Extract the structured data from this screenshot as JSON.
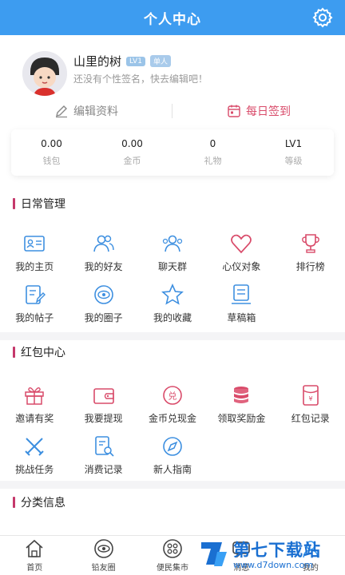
{
  "header": {
    "title": "个人中心"
  },
  "profile": {
    "username": "山里的树",
    "badges": [
      "LV1",
      "单人"
    ],
    "signature": "还没有个性签名，快去编辑吧！"
  },
  "actions": {
    "edit": "编辑资料",
    "checkin": "每日签到"
  },
  "stats": [
    {
      "value": "0.00",
      "label": "钱包"
    },
    {
      "value": "0.00",
      "label": "金币"
    },
    {
      "value": "0",
      "label": "礼物"
    },
    {
      "value": "LV1",
      "label": "等级"
    }
  ],
  "sections": {
    "daily": {
      "title": "日常管理",
      "items": [
        "我的主页",
        "我的好友",
        "聊天群",
        "心仪对象",
        "排行榜",
        "我的帖子",
        "我的圈子",
        "我的收藏",
        "草稿箱"
      ]
    },
    "redpacket": {
      "title": "红包中心",
      "items": [
        "邀请有奖",
        "我要提现",
        "金币兑现金",
        "领取奖励金",
        "红包记录",
        "挑战任务",
        "消费记录",
        "新人指南"
      ]
    },
    "category": {
      "title": "分类信息"
    }
  },
  "tabbar": [
    "首页",
    "铅友圈",
    "便民集市",
    "消息",
    "我的"
  ],
  "watermark": {
    "title": "第七下载站",
    "url": "www.d7down.com"
  },
  "colors": {
    "primary": "#3d9cf0",
    "accent": "#d94b6a",
    "section_bar": "#c5386b"
  }
}
